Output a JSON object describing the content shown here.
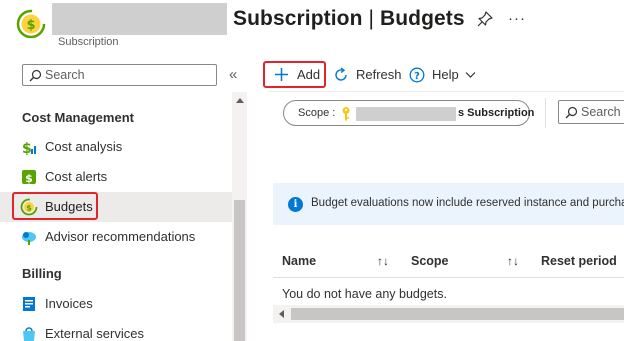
{
  "header": {
    "title_main": "Subscription",
    "title_sep": " | ",
    "title_section": "Budgets",
    "subtitle": "Subscription",
    "more_label": "···"
  },
  "nav": {
    "search_placeholder": "Search",
    "collapse_label": "«",
    "sections": [
      {
        "title": "Cost Management",
        "items": [
          {
            "label": "Cost analysis",
            "icon": "cost-analysis-icon"
          },
          {
            "label": "Cost alerts",
            "icon": "cost-alerts-icon"
          },
          {
            "label": "Budgets",
            "icon": "budgets-icon",
            "selected": true
          },
          {
            "label": "Advisor recommendations",
            "icon": "advisor-icon"
          }
        ]
      },
      {
        "title": "Billing",
        "items": [
          {
            "label": "Invoices",
            "icon": "invoices-icon"
          },
          {
            "label": "External services",
            "icon": "external-services-icon"
          }
        ]
      }
    ]
  },
  "toolbar": {
    "add_label": "Add",
    "refresh_label": "Refresh",
    "help_label": "Help"
  },
  "filters": {
    "scope_label": "Scope :",
    "scope_value": "s Subscription",
    "search_placeholder": "Search b"
  },
  "banner": {
    "text": "Budget evaluations now include reserved instance and purchase"
  },
  "table": {
    "columns": [
      "Name",
      "Scope",
      "Reset period"
    ],
    "sort_glyph": "↑↓",
    "empty_message": "You do not have any budgets."
  },
  "colors": {
    "accent": "#0078d4",
    "highlight_border": "#e3242b",
    "selected_bg": "#edebe9",
    "banner_bg": "#ebf3fc",
    "logo_green": "#57a300"
  }
}
